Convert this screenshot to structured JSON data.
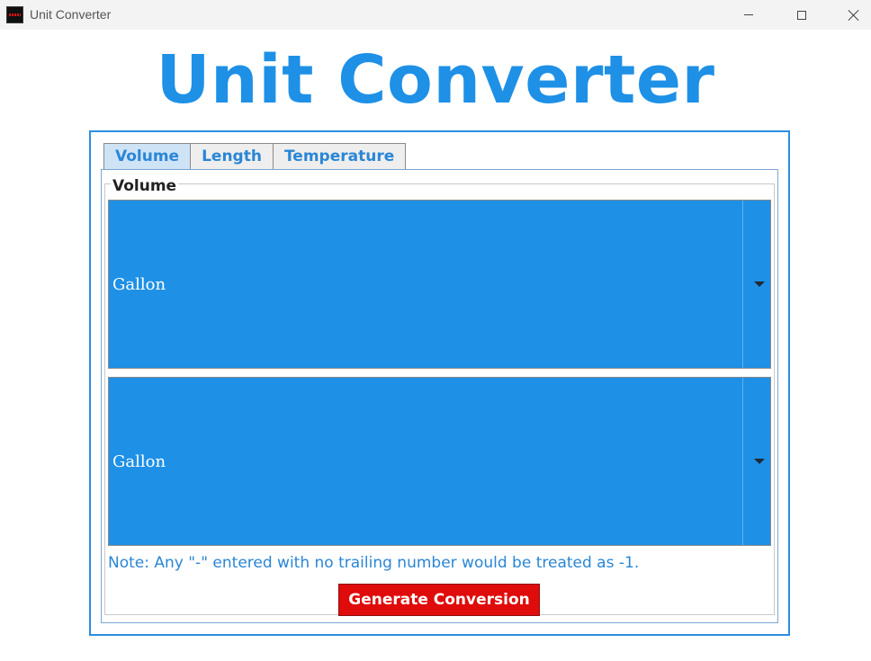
{
  "window": {
    "title": "Unit Converter",
    "icon": "app-icon",
    "controls": [
      "minimize-icon",
      "maximize-icon",
      "close-icon"
    ]
  },
  "heading": "Unit Converter",
  "tabs": [
    {
      "label": "Volume",
      "active": true
    },
    {
      "label": "Length",
      "active": false
    },
    {
      "label": "Temperature",
      "active": false
    }
  ],
  "panel": {
    "legend": "Volume",
    "from_unit": "Gallon",
    "to_unit": "Gallon",
    "note": "Note: Any \"-\" entered with no trailing number would be treated as -1.",
    "button_label": "Generate Conversion"
  },
  "colors": {
    "accent": "#1e90e6",
    "button": "#e00b0b"
  }
}
